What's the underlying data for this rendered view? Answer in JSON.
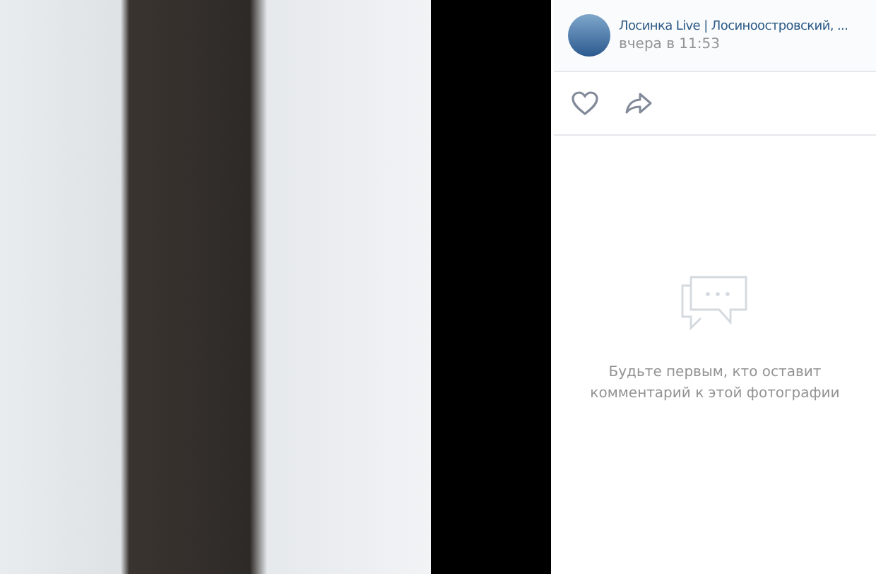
{
  "post": {
    "author": "Лосинка Live | Лосиноостровский, ...",
    "time": "вчера в 11:53"
  },
  "comments": {
    "empty_message": "Будьте первым, кто оставит комментарий к этой фотографии"
  }
}
